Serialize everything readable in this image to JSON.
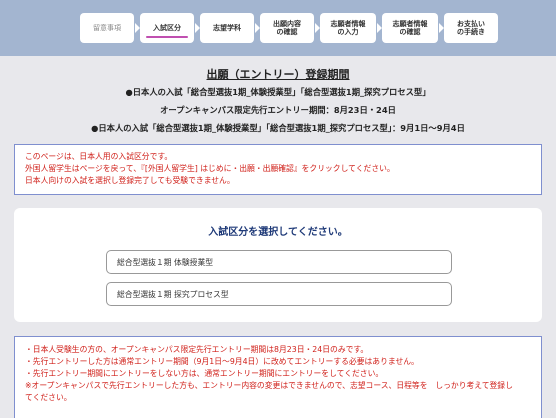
{
  "steps": [
    {
      "label": "留意事項",
      "state": "done"
    },
    {
      "label": "入試区分",
      "state": "active"
    },
    {
      "label": "志望学科",
      "state": "todo"
    },
    {
      "label": "出願内容\nの確認",
      "state": "todo"
    },
    {
      "label": "志願者情報\nの入力",
      "state": "todo"
    },
    {
      "label": "志願者情報\nの確認",
      "state": "todo"
    },
    {
      "label": "お支払い\nの手続き",
      "state": "todo"
    }
  ],
  "header": {
    "title": "出願（エントリー）登録期間",
    "line1": "●日本人の入試「総合型選抜1期_体験授業型」「総合型選抜1期_探究プロセス型」",
    "line2": "オープンキャンパス限定先行エントリー期間：8月23日・24日",
    "line3": "●日本人の入試「総合型選抜1期_体験授業型」「総合型選抜1期_探究プロセス型」：9月1日〜9月4日"
  },
  "notice": {
    "lines": [
      "このページは、日本人用の入試区分です。",
      "外国人留学生はページを戻って、『[外国人留学生] はじめに・出願・出願確認』をクリックしてください。",
      "日本人向けの入試を選択し登録完了しても受験できません。"
    ]
  },
  "selection": {
    "title": "入試区分を選択してください。",
    "options": [
      "総合型選抜１期 体験授業型",
      "総合型選抜１期 探究プロセス型"
    ]
  },
  "notice2": {
    "lines": [
      "・日本人受験生の方の、オープンキャンパス限定先行エントリー期間は8月23日・24日のみです。",
      "・先行エントリーした方は通常エントリー期間（9月1日〜9月4日）に改めてエントリーする必要はありません。",
      "・先行エントリー期間にエントリーをしない方は、通常エントリー期間にエントリーをしてください。",
      "※オープンキャンパスで先行エントリーした方も、エントリー内容の変更はできませんので、志望コース、日程等を　しっかり考えて登録し",
      "てください。"
    ]
  },
  "colors": {
    "accent": "#c04fb0",
    "stepbar": "#a3b5d0",
    "notice_text": "#d0201a",
    "title_blue": "#1f3a78"
  }
}
